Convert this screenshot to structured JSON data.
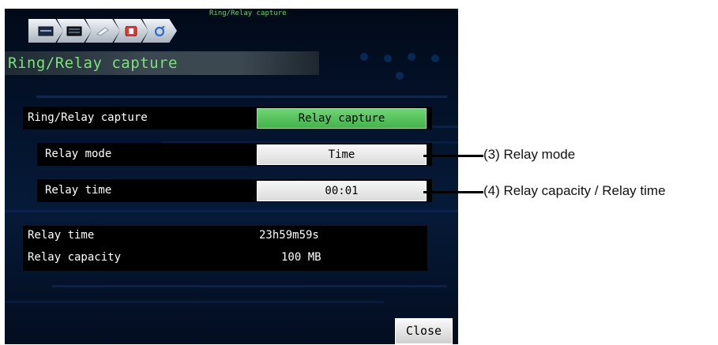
{
  "breadcrumb": {
    "caption": "Ring/Relay capture",
    "icons": [
      "monitor-icon",
      "display-icon",
      "menu-icon",
      "stop-record-icon",
      "settings-icon"
    ]
  },
  "page_title": "Ring/Relay capture",
  "rows": {
    "capture": {
      "label": "Ring/Relay capture",
      "value": "Relay capture"
    },
    "mode": {
      "label": "Relay mode",
      "value": "Time"
    },
    "time": {
      "label": "Relay time",
      "value": "00:01"
    }
  },
  "info": {
    "time": {
      "label": "Relay time",
      "value": "23h59m59s"
    },
    "capacity": {
      "label": "Relay capacity",
      "value": "100 MB"
    }
  },
  "close_label": "Close",
  "callouts": {
    "mode": "(3) Relay mode",
    "time": "(4) Relay capacity / Relay time"
  },
  "colors": {
    "accent_green": "#4cb954",
    "title_green": "#7de07d"
  }
}
